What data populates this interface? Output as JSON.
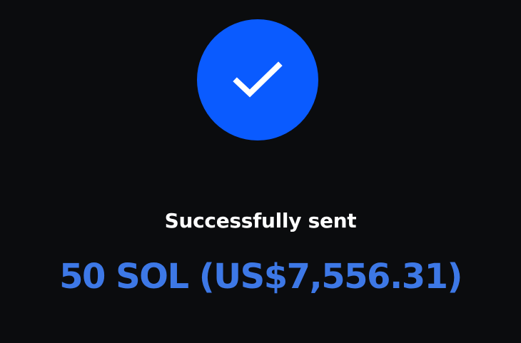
{
  "colors": {
    "background": "#0b0c0e",
    "success_circle": "#0a5bff",
    "checkmark": "#ffffff",
    "status_text": "#ffffff",
    "amount_text": "#3d78e6"
  },
  "icon": {
    "name": "checkmark-icon"
  },
  "status": {
    "label": "Successfully sent"
  },
  "amount": {
    "label": "50 SOL (US$7,556.31)"
  }
}
